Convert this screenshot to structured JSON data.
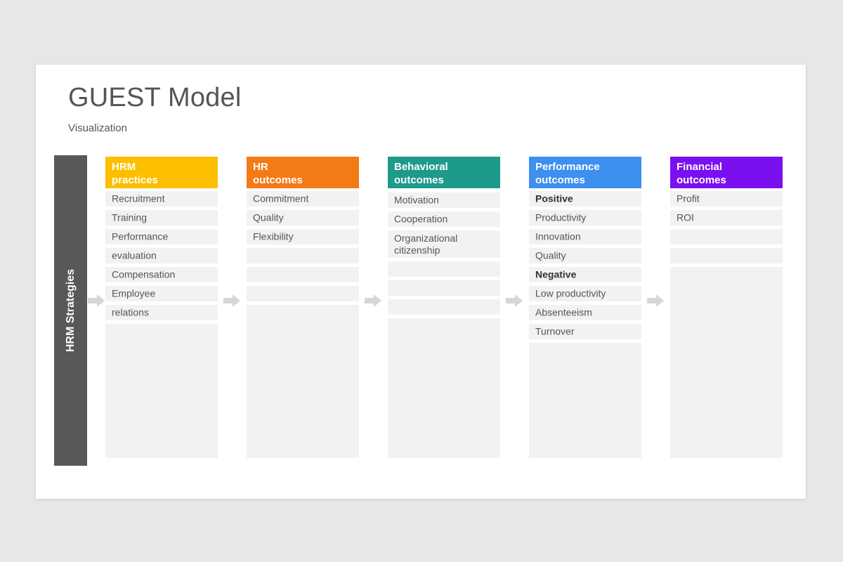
{
  "title": "GUEST Model",
  "subtitle": "Visualization",
  "side_label": "HRM Strategies",
  "colors": {
    "background": "#e8e6e7",
    "slide": "#ffffff",
    "side_bar": "#585858",
    "cell": "#f2f2f2",
    "arrow": "#d6d6d6"
  },
  "columns": [
    {
      "header": [
        "HRM",
        "practices"
      ],
      "color": "#fbbf00",
      "items": [
        {
          "text": "Recruitment"
        },
        {
          "text": "Training"
        },
        {
          "text": "Performance"
        },
        {
          "text": "evaluation"
        },
        {
          "text": "Compensation"
        },
        {
          "text": "Employee"
        },
        {
          "text": "relations"
        }
      ]
    },
    {
      "header": [
        "HR",
        "outcomes"
      ],
      "color": "#f47a16",
      "items": [
        {
          "text": "Commitment"
        },
        {
          "text": "Quality"
        },
        {
          "text": "Flexibility"
        },
        {
          "text": ""
        },
        {
          "text": ""
        },
        {
          "text": ""
        }
      ]
    },
    {
      "header": [
        "Behavioral",
        "outcomes"
      ],
      "color": "#1d9a8a",
      "items": [
        {
          "text": "Motivation"
        },
        {
          "text": "Cooperation"
        },
        {
          "text": "Organizational citizenship"
        },
        {
          "text": ""
        },
        {
          "text": ""
        },
        {
          "text": ""
        }
      ]
    },
    {
      "header": [
        "Performance",
        "outcomes"
      ],
      "color": "#3d8ff0",
      "items": [
        {
          "text": "Positive",
          "bold": true
        },
        {
          "text": "Productivity"
        },
        {
          "text": "Innovation"
        },
        {
          "text": "Quality"
        },
        {
          "text": "Negative",
          "bold": true
        },
        {
          "text": "Low productivity"
        },
        {
          "text": "Absenteeism"
        },
        {
          "text": "Turnover"
        }
      ]
    },
    {
      "header": [
        "Financial",
        "outcomes"
      ],
      "color": "#7a0ff0",
      "items": [
        {
          "text": "Profit"
        },
        {
          "text": "ROI"
        },
        {
          "text": ""
        },
        {
          "text": ""
        }
      ]
    }
  ]
}
